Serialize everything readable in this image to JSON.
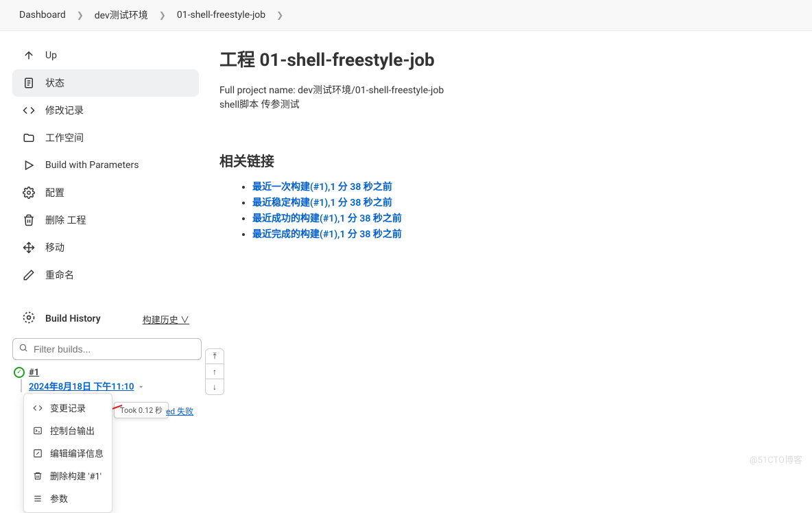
{
  "breadcrumb": {
    "items": [
      "Dashboard",
      "dev测试环境",
      "01-shell-freestyle-job"
    ]
  },
  "sidebar": {
    "items": [
      {
        "label": "Up"
      },
      {
        "label": "状态"
      },
      {
        "label": "修改记录"
      },
      {
        "label": "工作空间"
      },
      {
        "label": "Build with Parameters"
      },
      {
        "label": "配置"
      },
      {
        "label": "删除 工程"
      },
      {
        "label": "移动"
      },
      {
        "label": "重命名"
      }
    ]
  },
  "build_history": {
    "title": "Build History",
    "link": "构建历史",
    "filter_placeholder": "Filter builds...",
    "build": {
      "number": "#1",
      "date": "2024年8月18日 下午11:10"
    },
    "took": "Took 0.12 秒",
    "feed": "ed 失败"
  },
  "popup": {
    "items": [
      {
        "label": "变更记录"
      },
      {
        "label": "控制台输出"
      },
      {
        "label": "编辑编译信息"
      },
      {
        "label": "删除构建 '#1'"
      },
      {
        "label": "参数"
      }
    ]
  },
  "main": {
    "title": "工程 01-shell-freestyle-job",
    "full_name_line": "Full project name: dev测试环境/01-shell-freestyle-job",
    "desc_line": "shell脚本  传参测试",
    "links_title": "相关链接",
    "links": [
      "最近一次构建(#1),1 分 38 秒之前",
      "最近稳定构建(#1),1 分 38 秒之前",
      "最近成功的构建(#1),1 分 38 秒之前",
      "最近完成的构建(#1),1 分 38 秒之前"
    ]
  },
  "watermark": "@51CTO博客"
}
